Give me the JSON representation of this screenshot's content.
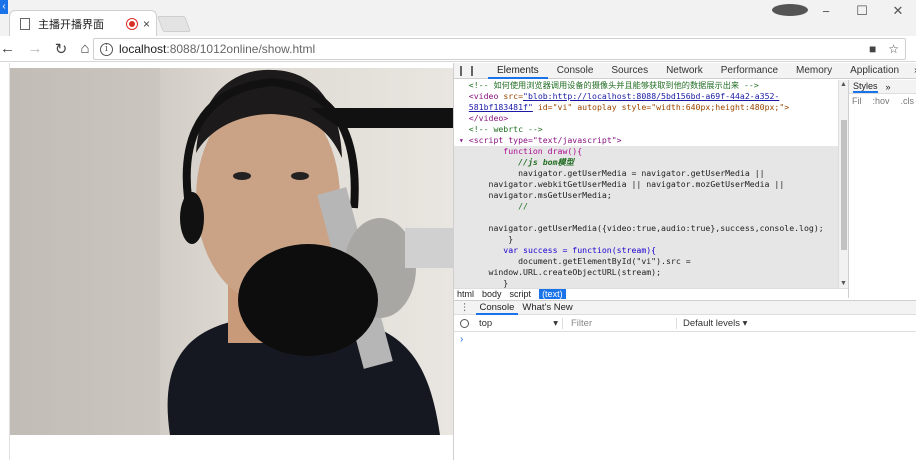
{
  "browser": {
    "tab_title": "主播开播界面",
    "tab_close": "×",
    "url_host": "localhost",
    "url_rest": ":8088/1012online/show.html",
    "window_controls": [
      "−",
      "☐",
      "✕"
    ]
  },
  "devtools": {
    "tabs": [
      "Elements",
      "Console",
      "Sources",
      "Network",
      "Performance",
      "Memory",
      "Application"
    ],
    "active_tab": "Elements",
    "more": "»",
    "styles_tabs": [
      "Styles",
      "»"
    ],
    "styles_filter": "Fil",
    "styles_hov": ":hov",
    "styles_cls": ".cls",
    "breadcrumb": [
      "html",
      "body",
      "script",
      "(text)"
    ],
    "drawer_tabs": [
      "Console",
      "What's New"
    ],
    "console_context": "top",
    "console_filter_placeholder": "Filter",
    "console_levels": "Default levels ▾",
    "console_prompt": "›",
    "code": {
      "l1": "<!-- 如何使用浏览器调用设备的摄像头并且能够获取到他的数据展示出来 -->",
      "l2_tag": "<video ",
      "l2_attr": "src=",
      "l2_link": "\"blob:http://localhost:8088/5bd156bd-a69f-44a2-a352-",
      "l3_link": "581bf183481f\"",
      "l3_rest": " id=\"vi\" autoplay style=\"width:640px;height:480px;\">",
      "l4": "</video>",
      "l5": "<!-- webrtc -->",
      "l6": "<script type=\"text/javascript\">",
      "l7": "function draw(){",
      "l8": "//js bom模型",
      "l9": "navigator.getUserMedia = navigator.getUserMedia ||",
      "l10": "navigator.webkitGetUserMedia || navigator.mozGetUserMedia ||",
      "l11": "navigator.msGetUserMedia;",
      "l12": "//",
      "l13": "",
      "l14": "navigator.getUserMedia({video:true,audio:true},success,console.log);",
      "l15": "}",
      "l16": "var success = function(stream){",
      "l17": "document.getElementById(\"vi\").src =",
      "l18": "window.URL.createObjectURL(stream);",
      "l19": "}"
    }
  }
}
